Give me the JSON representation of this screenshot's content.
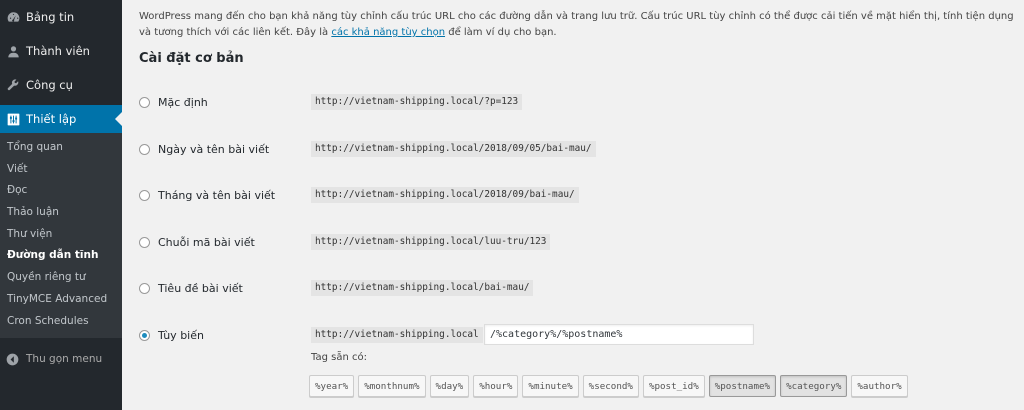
{
  "sidebar": {
    "top_items": [
      {
        "label": "Bảng tin",
        "icon": "dashboard-icon"
      },
      {
        "label": "Thành viên",
        "icon": "users-icon"
      },
      {
        "label": "Công cụ",
        "icon": "wrench-icon"
      },
      {
        "label": "Thiết lập",
        "icon": "settings-icon",
        "current": true
      }
    ],
    "submenu": [
      "Tổng quan",
      "Viết",
      "Đọc",
      "Thảo luận",
      "Thư viện",
      "Đường dẫn tĩnh",
      "Quyền riêng tư",
      "TinyMCE Advanced",
      "Cron Schedules"
    ],
    "active_submenu": "Đường dẫn tĩnh",
    "collapse_label": "Thu gọn menu"
  },
  "intro": {
    "text_before": "WordPress mang đến cho bạn khả năng tùy chỉnh cấu trúc URL cho các đường dẫn và trang lưu trữ. Cấu trúc URL tùy chỉnh có thể được cải tiến về mặt hiển thị, tính tiện dụng và tương thích với các liên kết. Đây là ",
    "link_text": "các khả năng tùy chọn",
    "text_after": " để làm ví dụ cho bạn."
  },
  "section_title": "Cài đặt cơ bản",
  "options": [
    {
      "label": "Mặc định",
      "example": "http://vietnam-shipping.local/?p=123",
      "checked": false
    },
    {
      "label": "Ngày và tên bài viết",
      "example": "http://vietnam-shipping.local/2018/09/05/bai-mau/",
      "checked": false
    },
    {
      "label": "Tháng và tên bài viết",
      "example": "http://vietnam-shipping.local/2018/09/bai-mau/",
      "checked": false
    },
    {
      "label": "Chuỗi mã bài viết",
      "example": "http://vietnam-shipping.local/luu-tru/123",
      "checked": false
    },
    {
      "label": "Tiêu đề bài viết",
      "example": "http://vietnam-shipping.local/bai-mau/",
      "checked": false
    },
    {
      "label": "Tùy biến",
      "example": "http://vietnam-shipping.local",
      "checked": true
    }
  ],
  "custom_structure_value": "/%category%/%postname%",
  "tags_label": "Tag sẵn có:",
  "tags": [
    {
      "label": "%year%",
      "pressed": false
    },
    {
      "label": "%monthnum%",
      "pressed": false
    },
    {
      "label": "%day%",
      "pressed": false
    },
    {
      "label": "%hour%",
      "pressed": false
    },
    {
      "label": "%minute%",
      "pressed": false
    },
    {
      "label": "%second%",
      "pressed": false
    },
    {
      "label": "%post_id%",
      "pressed": false
    },
    {
      "label": "%postname%",
      "pressed": true
    },
    {
      "label": "%category%",
      "pressed": true
    },
    {
      "label": "%author%",
      "pressed": false
    }
  ],
  "colors": {
    "sidebar_bg": "#23282d",
    "submenu_bg": "#32373c",
    "accent": "#0073aa",
    "page_bg": "#f1f1f1"
  }
}
